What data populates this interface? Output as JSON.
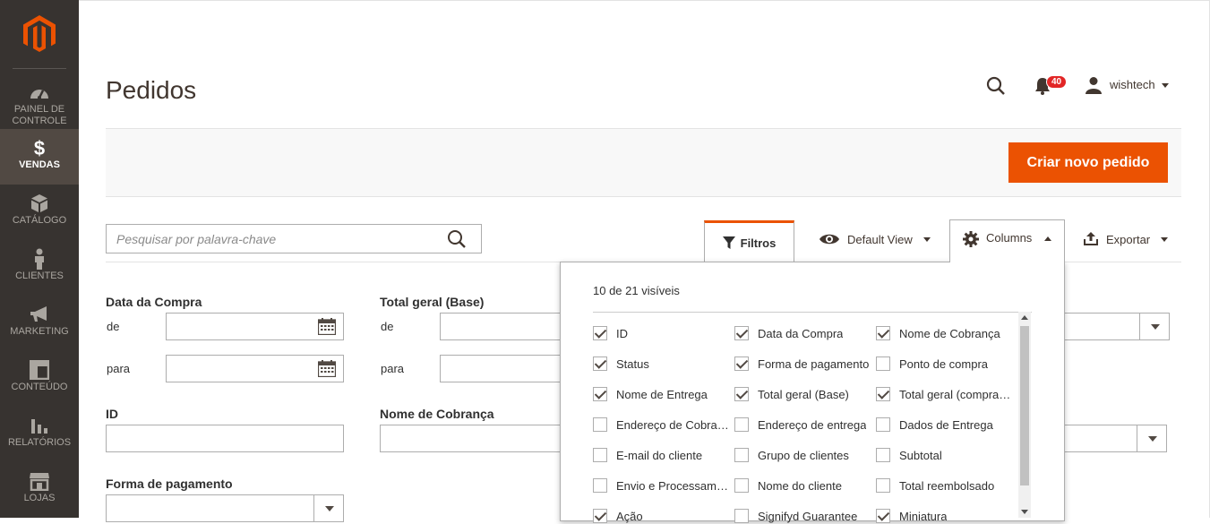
{
  "sidebar": {
    "items": [
      {
        "label": "PAINEL DE CONTROLE",
        "icon": "dashboard-icon"
      },
      {
        "label": "VENDAS",
        "icon": "dollar-icon",
        "active": true
      },
      {
        "label": "CATÁLOGO",
        "icon": "box-icon"
      },
      {
        "label": "CLIENTES",
        "icon": "person-icon"
      },
      {
        "label": "MARKETING",
        "icon": "megaphone-icon"
      },
      {
        "label": "CONTEÚDO",
        "icon": "layout-icon"
      },
      {
        "label": "RELATÓRIOS",
        "icon": "bar-chart-icon"
      },
      {
        "label": "LOJAS",
        "icon": "store-icon"
      }
    ],
    "colors": {
      "bg": "#373330",
      "active_bg": "#514943",
      "logo": "#eb5202"
    }
  },
  "header": {
    "title": "Pedidos",
    "notifications_count": "40",
    "user": "wishtech"
  },
  "actions": {
    "create_order": "Criar novo pedido",
    "accent": "#eb5202"
  },
  "toolbar": {
    "search_placeholder": "Pesquisar por palavra-chave",
    "filters": "Filtros",
    "view": "Default View",
    "columns": "Columns",
    "export": "Exportar"
  },
  "filters": {
    "purchase_date": "Data da Compra",
    "grand_total_base": "Total geral (Base)",
    "from": "de",
    "to": "para",
    "id": "ID",
    "billing_name": "Nome de Cobrança",
    "payment_method": "Forma de pagamento"
  },
  "columns_panel": {
    "count": "10 de 21 visíveis",
    "items": [
      {
        "label": "ID",
        "checked": true
      },
      {
        "label": "Data da Compra",
        "checked": true
      },
      {
        "label": "Nome de Cobrança",
        "checked": true
      },
      {
        "label": "Status",
        "checked": true
      },
      {
        "label": "Forma de pagamento",
        "checked": true
      },
      {
        "label": "Ponto de compra",
        "checked": false
      },
      {
        "label": "Nome de Entrega",
        "checked": true
      },
      {
        "label": "Total geral (Base)",
        "checked": true
      },
      {
        "label": "Total geral (comprado)",
        "checked": true
      },
      {
        "label": "Endereço de Cobrança",
        "checked": false
      },
      {
        "label": "Endereço de entrega",
        "checked": false
      },
      {
        "label": "Dados de Entrega",
        "checked": false
      },
      {
        "label": "E-mail do cliente",
        "checked": false
      },
      {
        "label": "Grupo de clientes",
        "checked": false
      },
      {
        "label": "Subtotal",
        "checked": false
      },
      {
        "label": "Envio e Processamento",
        "checked": false
      },
      {
        "label": "Nome do cliente",
        "checked": false
      },
      {
        "label": "Total reembolsado",
        "checked": false
      },
      {
        "label": "Ação",
        "checked": true
      },
      {
        "label": "Signifyd Guarantee",
        "checked": false
      },
      {
        "label": "Miniatura",
        "checked": true
      }
    ]
  }
}
